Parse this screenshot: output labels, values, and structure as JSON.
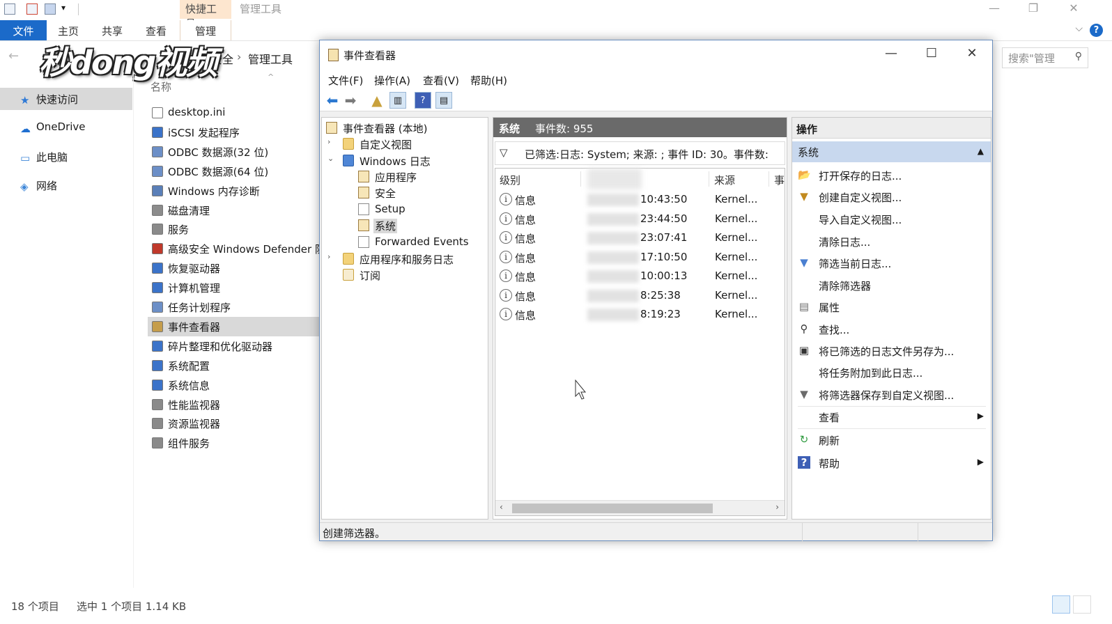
{
  "explorer": {
    "context_tab": "快捷工具",
    "context_tab_inactive": "管理工具",
    "ribbon_tabs": [
      "文件",
      "主页",
      "共享",
      "查看",
      "管理"
    ],
    "breadcrumb_partial": "和安全",
    "breadcrumb_current": "管理工具",
    "search_placeholder": "搜索\"管理",
    "column_name": "名称",
    "nav": [
      {
        "label": "快速访问",
        "icon": "star-icon"
      },
      {
        "label": "OneDrive",
        "icon": "cloud-icon"
      },
      {
        "label": "此电脑",
        "icon": "computer-icon"
      },
      {
        "label": "网络",
        "icon": "network-icon"
      }
    ],
    "files": [
      "desktop.ini",
      "iSCSI 发起程序",
      "ODBC 数据源(32 位)",
      "ODBC 数据源(64 位)",
      "Windows 内存诊断",
      "磁盘清理",
      "服务",
      "高级安全 Windows Defender 防",
      "恢复驱动器",
      "计算机管理",
      "任务计划程序",
      "事件查看器",
      "碎片整理和优化驱动器",
      "系统配置",
      "系统信息",
      "性能监视器",
      "资源监视器",
      "组件服务"
    ],
    "selected_file_index": 11,
    "status_count": "18 个项目",
    "status_selected": "选中 1 个项目  1.14 KB"
  },
  "watermark": "秒dong视频",
  "event_viewer": {
    "title": "事件查看器",
    "menu": [
      "文件(F)",
      "操作(A)",
      "查看(V)",
      "帮助(H)"
    ],
    "tree": {
      "root": "事件查看器 (本地)",
      "custom_views": "自定义视图",
      "windows_logs": "Windows 日志",
      "logs": [
        "应用程序",
        "安全",
        "Setup",
        "系统",
        "Forwarded Events"
      ],
      "app_service_logs": "应用程序和服务日志",
      "subscriptions": "订阅"
    },
    "log_header_name": "系统",
    "log_header_count": "事件数: 955",
    "filter_text": "已筛选:日志: System; 来源: ; 事件 ID: 30。事件数:",
    "grid_headers": {
      "level": "级别",
      "source": "来源",
      "event": "事"
    },
    "events": [
      {
        "level": "信息",
        "time": "10:43:50",
        "source": "Kernel..."
      },
      {
        "level": "信息",
        "time": "23:44:50",
        "source": "Kernel..."
      },
      {
        "level": "信息",
        "time": "23:07:41",
        "source": "Kernel..."
      },
      {
        "level": "信息",
        "time": "17:10:50",
        "source": "Kernel..."
      },
      {
        "level": "信息",
        "time": "10:00:13",
        "source": "Kernel..."
      },
      {
        "level": "信息",
        "time": "8:25:38",
        "source": "Kernel..."
      },
      {
        "level": "信息",
        "time": "8:19:23",
        "source": "Kernel..."
      }
    ],
    "actions_header": "操作",
    "actions_section": "系统",
    "actions": [
      {
        "label": "打开保存的日志...",
        "icon": "folder-open-icon",
        "glyph": "📂"
      },
      {
        "label": "创建自定义视图...",
        "icon": "filter-create-icon",
        "glyph": "▼"
      },
      {
        "label": "导入自定义视图...",
        "icon": "",
        "glyph": ""
      },
      {
        "label": "清除日志...",
        "icon": "",
        "glyph": ""
      },
      {
        "label": "筛选当前日志...",
        "icon": "filter-icon",
        "glyph": "▼"
      },
      {
        "label": "清除筛选器",
        "icon": "",
        "glyph": ""
      },
      {
        "label": "属性",
        "icon": "properties-icon",
        "glyph": "▤"
      },
      {
        "label": "查找...",
        "icon": "binoculars-icon",
        "glyph": "⚲"
      },
      {
        "label": "将已筛选的日志文件另存为...",
        "icon": "save-icon",
        "glyph": "▣"
      },
      {
        "label": "将任务附加到此日志...",
        "icon": "",
        "glyph": ""
      },
      {
        "label": "将筛选器保存到自定义视图...",
        "icon": "filter-save-icon",
        "glyph": "▼"
      },
      {
        "label": "查看",
        "icon": "",
        "glyph": "",
        "submenu": true
      },
      {
        "label": "刷新",
        "icon": "refresh-icon",
        "glyph": "↻"
      },
      {
        "label": "帮助",
        "icon": "help-icon",
        "glyph": "?",
        "submenu": true
      }
    ],
    "status": "创建筛选器。"
  },
  "colors": {
    "ribbon_file": "#1b6ac9",
    "context_tab": "#fde6cf",
    "selection": "#d9d9d9",
    "log_header": "#6a6a6a",
    "actions_section": "#c8d8ee"
  }
}
